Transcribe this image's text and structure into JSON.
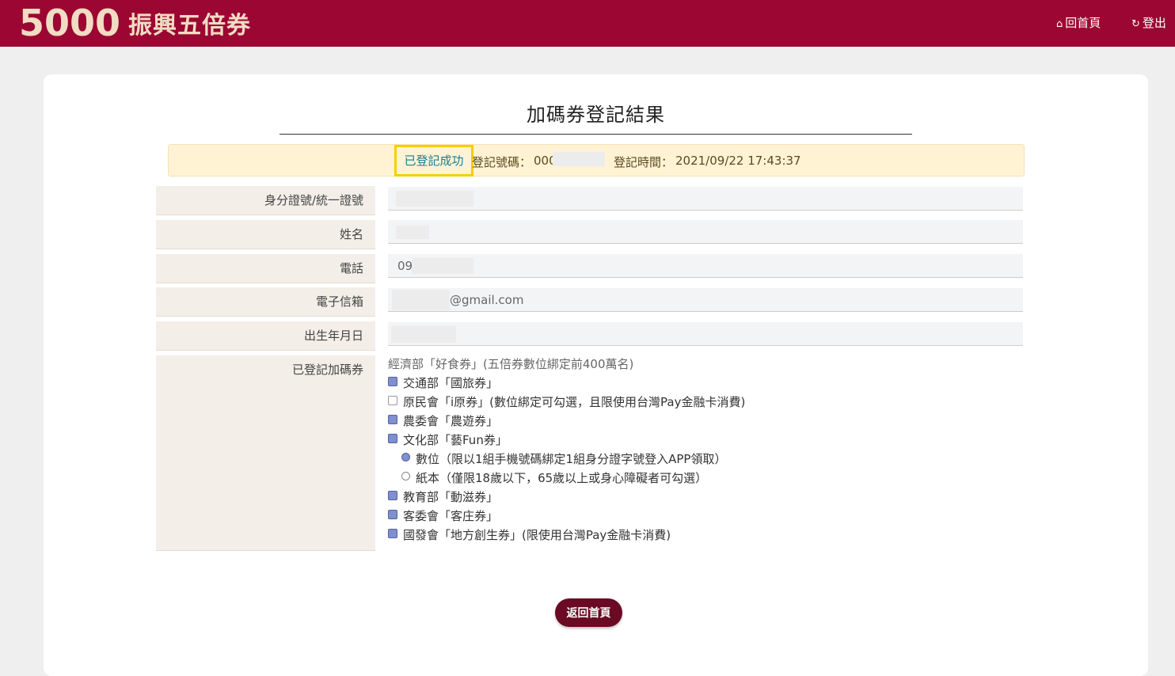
{
  "colors": {
    "brand": "#9c0632",
    "logo_cream": "#f1dcc4",
    "page_bg": "#efefef",
    "alert_bg": "#fff3d4",
    "highlight": "#f6cf00",
    "teal": "#1a7d96",
    "label_bg": "#f3efe8",
    "field_bg": "#f3f4f6",
    "checkbox_checked": "#7f8fcf",
    "button_bg": "#6a0a23"
  },
  "header": {
    "logo_number": "5000",
    "logo_text": "振興五倍券",
    "home_icon": "home-icon",
    "home_label": "回首頁",
    "logout_icon": "logout-icon",
    "logout_label": "登出"
  },
  "page_title": "加碼券登記結果",
  "result": {
    "status": "已登記成功",
    "reg_no_label": "登記號碼：",
    "reg_no_value": "000",
    "reg_time_label": "登記時間：",
    "reg_time_value": "2021/09/22 17:43:37"
  },
  "fields": {
    "id_label": "身分證號/統一證號",
    "id_value": "",
    "name_label": "姓名",
    "name_value": "",
    "phone_label": "電話",
    "phone_value": "09",
    "email_label": "電子信箱",
    "email_value": "@gmail.com",
    "birth_label": "出生年月日",
    "birth_value": "",
    "coupons_label": "已登記加碼券"
  },
  "coupons": {
    "intro": "經濟部「好食券」(五倍券數位綁定前400萬名)",
    "items": [
      {
        "label": "交通部「國旅券」",
        "checked": true
      },
      {
        "label": "原民會「i原券」(數位綁定可勾選，且限使用台灣Pay金融卡消費)",
        "checked": false
      },
      {
        "label": "農委會「農遊券」",
        "checked": true
      },
      {
        "label": "文化部「藝Fun券」",
        "checked": true
      },
      {
        "label": "教育部「動滋券」",
        "checked": true
      },
      {
        "label": "客委會「客庄券」",
        "checked": true
      },
      {
        "label": "國發會「地方創生券」(限使用台灣Pay金融卡消費)",
        "checked": true
      }
    ],
    "sub_options": [
      {
        "label": "數位（限以1組手機號碼綁定1組身分證字號登入APP領取）",
        "selected": true
      },
      {
        "label": "紙本（僅限18歲以下，65歲以上或身心障礙者可勾選）",
        "selected": false
      }
    ]
  },
  "back_button": "返回首頁"
}
